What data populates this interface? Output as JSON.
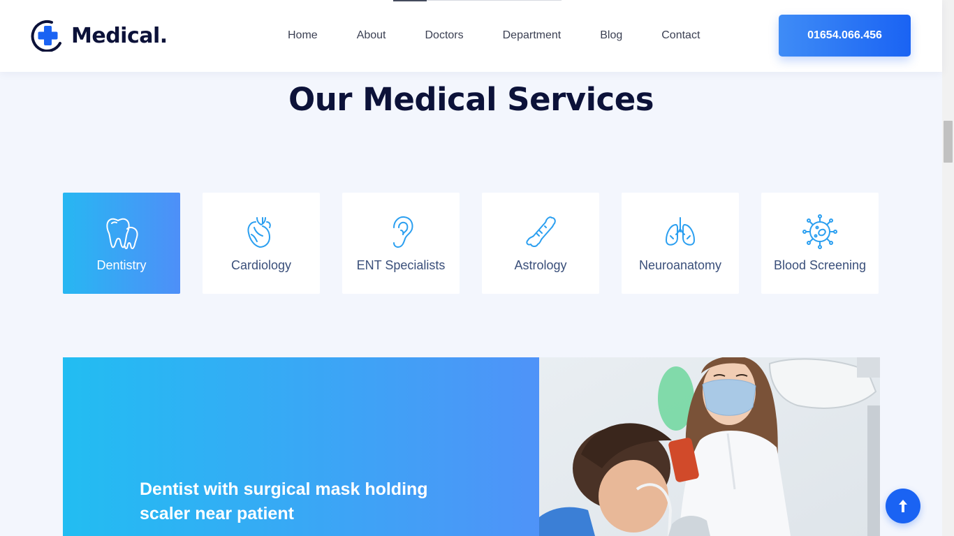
{
  "header": {
    "logo_text": "Medical.",
    "nav": [
      "Home",
      "About",
      "Doctors",
      "Department",
      "Blog",
      "Contact"
    ],
    "phone": "01654.066.456"
  },
  "section": {
    "title": "Our Medical Services"
  },
  "services": [
    {
      "label": "Dentistry",
      "icon": "tooth-icon",
      "active": true
    },
    {
      "label": "Cardiology",
      "icon": "heart-icon",
      "active": false
    },
    {
      "label": "ENT Specialists",
      "icon": "ear-icon",
      "active": false
    },
    {
      "label": "Astrology",
      "icon": "bone-icon",
      "active": false
    },
    {
      "label": "Neuroanatomy",
      "icon": "lungs-icon",
      "active": false
    },
    {
      "label": "Blood Screening",
      "icon": "virus-icon",
      "active": false
    }
  ],
  "feature": {
    "title": "Dentist with surgical mask holding scaler near patient",
    "photo": "dentist-photo"
  },
  "colors": {
    "primary": "#1a63f3",
    "gradient_start": "#22bdf2",
    "gradient_end": "#4f93f8",
    "heading": "#0c1239",
    "background": "#f3f6fd"
  }
}
